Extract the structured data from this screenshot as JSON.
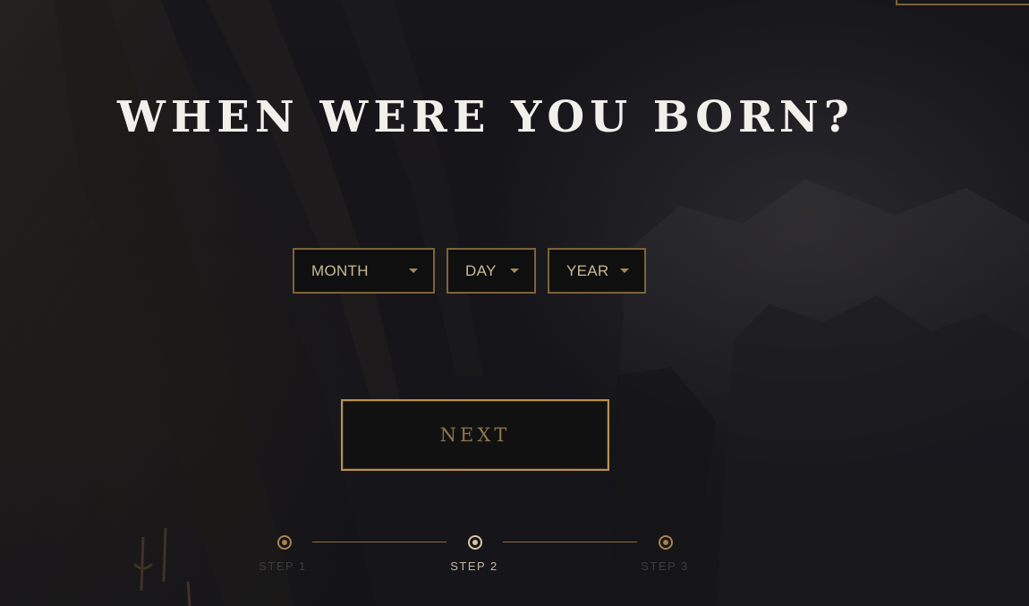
{
  "page": {
    "title": "WHEN WERE YOU BORN?"
  },
  "birthdate": {
    "month": {
      "placeholder": "MONTH",
      "icon": "caret-down-icon"
    },
    "day": {
      "placeholder": "DAY",
      "icon": "caret-down-icon"
    },
    "year": {
      "placeholder": "YEAR",
      "icon": "caret-down-icon"
    }
  },
  "actions": {
    "next_label": "NEXT"
  },
  "steps": {
    "items": [
      {
        "label": "STEP 1",
        "state": "complete"
      },
      {
        "label": "STEP 2",
        "state": "current"
      },
      {
        "label": "STEP 3",
        "state": "upcoming"
      }
    ],
    "current_index": 2,
    "total": 3
  },
  "colors": {
    "accent_gold": "#b8914f",
    "muted_gold": "#8d7649",
    "title_text": "#f2f0ea",
    "background": "#141419"
  }
}
